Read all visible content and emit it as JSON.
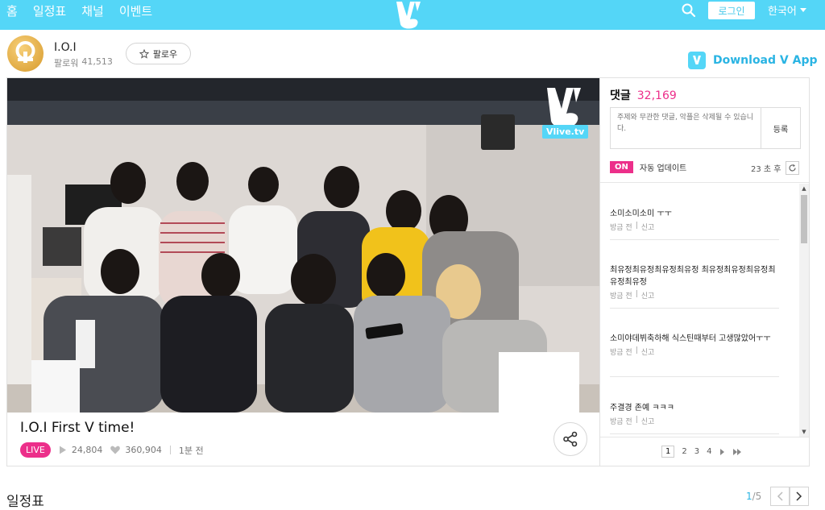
{
  "nav": {
    "items": [
      "홈",
      "일정표",
      "채널",
      "이벤트"
    ]
  },
  "header": {
    "login_label": "로그인",
    "language_label": "한국어"
  },
  "channel": {
    "name": "I.O.I",
    "followers_label": "팔로워",
    "followers_count": "41,513",
    "follow_label": "팔로우"
  },
  "download": {
    "label": "Download V App"
  },
  "video": {
    "title": "I.O.I First V time!",
    "live_label": "LIVE",
    "plays": "24,804",
    "likes": "360,904",
    "time_ago": "1분 전",
    "watermark": "Vlive.tv"
  },
  "comments": {
    "heading": "댓글",
    "count": "32,169",
    "placeholder": "주제와 무관한 댓글, 악플은 삭제될 수 있습니다.",
    "submit_label": "등록",
    "auto_on_label": "ON",
    "auto_update_label": "자동 업데이트",
    "timer_label": "23 초 후",
    "items": [
      {
        "text": "소미소미소미 ㅜㅜ",
        "time": "방금 전",
        "report": "신고"
      },
      {
        "text": "최유정최유정최유정최유정 최유정최유정최유정최유정최유정",
        "time": "방금 전",
        "report": "신고"
      },
      {
        "text": "소미야데뷔축하해 식스틴때부터 고생많았어ㅜㅜ",
        "time": "방금 전",
        "report": "신고"
      },
      {
        "text": "주결경 존예 ㅋㅋㅋ",
        "time": "방금 전",
        "report": "신고"
      }
    ],
    "pages": [
      "1",
      "2",
      "3",
      "4"
    ]
  },
  "schedule": {
    "title": "일정표",
    "current": "1",
    "total": "/5"
  },
  "colors": {
    "topbar": "#54d6f7",
    "accent_pink": "#ec2f8a",
    "accent_blue": "#2ab4e3"
  }
}
